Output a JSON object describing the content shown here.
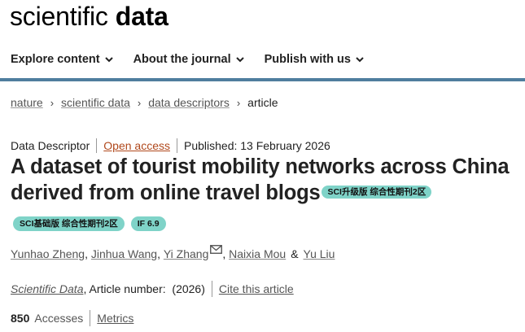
{
  "brand": {
    "light": "scientific",
    "bold": "data"
  },
  "nav": [
    {
      "label": "Explore content"
    },
    {
      "label": "About the journal"
    },
    {
      "label": "Publish with us"
    }
  ],
  "breadcrumb": {
    "items": [
      "nature",
      "scientific data",
      "data descriptors"
    ],
    "current": "article",
    "separator": "›"
  },
  "meta": {
    "type": "Data Descriptor",
    "access": "Open access",
    "published": "Published: 13 February 2026"
  },
  "article": {
    "title": "A dataset of tourist mobility networks across China derived from online travel blogs",
    "title_badge": "SCI升级版 综合性期刊2区",
    "badges": [
      "SCI基础版 综合性期刊2区",
      "IF 6.9"
    ]
  },
  "authors": {
    "list": [
      "Yunhao Zheng",
      "Jinhua Wang",
      "Yi Zhang",
      "Naixia Mou",
      "Yu Liu"
    ],
    "separator": ", ",
    "conjunction": "&"
  },
  "citation": {
    "journal": "Scientific Data",
    "article_number": ", Article number:  (2026)",
    "cite_label": "Cite this article"
  },
  "metrics": {
    "accesses_count": "850",
    "accesses_label": "Accesses",
    "metrics_label": "Metrics"
  },
  "colors": {
    "accent_rule": "#4f7e9e",
    "badge": "#7fd3c8",
    "open_access": "#b0481c"
  },
  "icons": {
    "nav_dropdown": "chevron-down-icon",
    "breadcrumb_separator": "chevron-right-icon",
    "corresponding_author": "envelope-icon"
  }
}
